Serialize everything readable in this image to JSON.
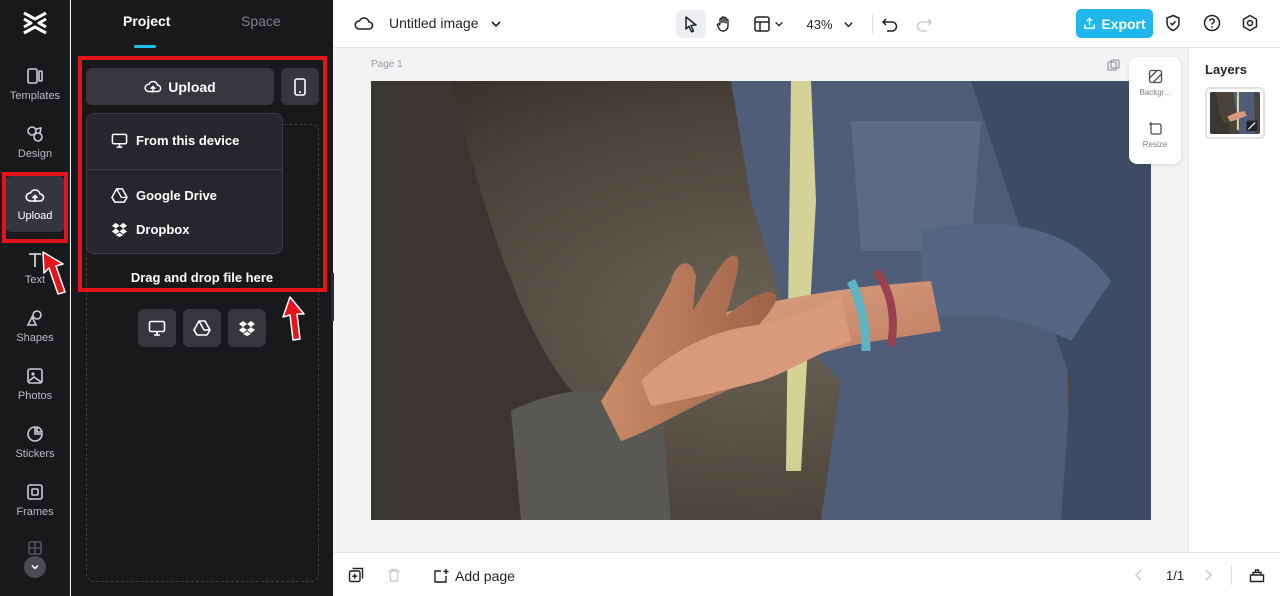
{
  "rail": {
    "items": [
      {
        "label": "Templates",
        "icon": "templates-icon"
      },
      {
        "label": "Design",
        "icon": "design-icon"
      },
      {
        "label": "Upload",
        "icon": "upload-cloud-icon",
        "active": true
      },
      {
        "label": "Text",
        "icon": "text-icon"
      },
      {
        "label": "Shapes",
        "icon": "shapes-icon"
      },
      {
        "label": "Photos",
        "icon": "photos-icon"
      },
      {
        "label": "Stickers",
        "icon": "stickers-icon"
      },
      {
        "label": "Frames",
        "icon": "frames-icon"
      }
    ]
  },
  "panel": {
    "tabs": [
      {
        "label": "Project",
        "active": true
      },
      {
        "label": "Space",
        "active": false
      }
    ],
    "upload_label": "Upload",
    "menu": {
      "items": [
        {
          "label": "From this device",
          "icon": "monitor-icon"
        },
        {
          "label": "Google Drive",
          "icon": "google-drive-icon"
        },
        {
          "label": "Dropbox",
          "icon": "dropbox-icon"
        }
      ]
    },
    "drag_text": "Drag and drop file here"
  },
  "topbar": {
    "title": "Untitled image",
    "zoom": "43%",
    "export_label": "Export"
  },
  "canvas": {
    "page_label": "Page 1",
    "float_tools": [
      {
        "label": "Backgr...",
        "icon": "background-icon"
      },
      {
        "label": "Resize",
        "icon": "resize-icon"
      }
    ]
  },
  "layers": {
    "title": "Layers"
  },
  "bottombar": {
    "add_page_label": "Add page",
    "page_count": "1/1"
  },
  "colors": {
    "accent": "#1fb8ec",
    "annotation": "#e3141c",
    "panel_bg": "#18191b"
  }
}
